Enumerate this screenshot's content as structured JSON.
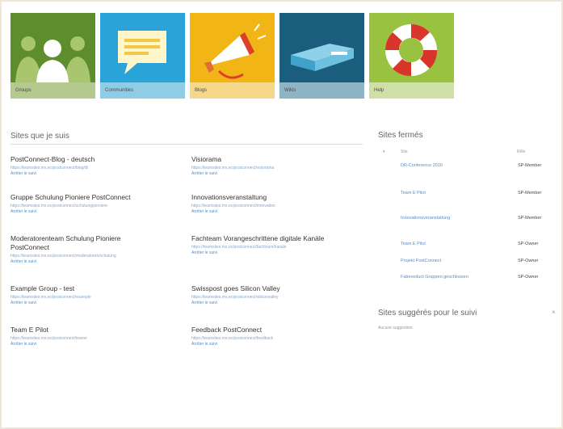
{
  "tiles": [
    {
      "label": "Groups",
      "bg": "#5e8d2c",
      "cap_bg": "#b3c98e",
      "icon": "people-icon"
    },
    {
      "label": "Communities",
      "bg": "#2aa3d8",
      "cap_bg": "#8fcde6",
      "icon": "speech-bubble-icon"
    },
    {
      "label": "Blogs",
      "bg": "#f1b515",
      "cap_bg": "#f5d88a",
      "icon": "megaphone-icon"
    },
    {
      "label": "Wikis",
      "bg": "#1a5d7c",
      "cap_bg": "#8db5c6",
      "icon": "book-icon"
    },
    {
      "label": "Help",
      "bg": "#98c23f",
      "cap_bg": "#cfe0a7",
      "icon": "lifebuoy-icon"
    }
  ],
  "followed": {
    "title": "Sites que je suis",
    "stop_label": "Arrêter le suivi",
    "left": [
      {
        "name": "PostConnect-Blog - deutsch",
        "url": "https://teamsites.ms.ec/postconnect/blog/dt"
      },
      {
        "name": "Gruppe Schulung Pioniere PostConnect",
        "url": "https://teamsites.ms.ec/postconnect/schulung/pioniere"
      },
      {
        "name": "Moderatorenteam Schulung Pioniere PostConnect",
        "url": "https://teamsites.ms.ec/postconnect/moderatoren/schulung"
      },
      {
        "name": "Example Group - test",
        "url": "https://teamsites.ms.ec/postconnect/example"
      },
      {
        "name": "Team E Pilot",
        "url": "https://teamsites.ms.ec/postconnect/teame"
      }
    ],
    "right": [
      {
        "name": "Visiorama",
        "url": "https://teamsites.ms.ec/postconnect/visiorama"
      },
      {
        "name": "Innovationsveranstaltung",
        "url": "https://teamsites.ms.ec/postconnect/innovation"
      },
      {
        "name": "Fachteam Vorangeschrittene digitale Kanäle",
        "url": "https://teamsites.ms.ec/postconnect/fachteam/kanale"
      },
      {
        "name": "Swisspost goes Silicon Valley",
        "url": "https://teamsites.ms.ec/postconnect/siliconvalley"
      },
      {
        "name": "Feedback PostConnect",
        "url": "https://teamsites.ms.ec/postconnect/feedback"
      }
    ]
  },
  "recent": {
    "title": "Sites fermés",
    "col_site": "Site",
    "col_role": "Rôle",
    "rows": [
      {
        "name": "DR-Conference 2016",
        "role": "SP-Member"
      },
      {
        "name": "Team E Pilot",
        "role": "SP-Member"
      },
      {
        "name": "Innovationsveranstaltung",
        "role": "SP-Member"
      },
      {
        "name": "Team E Pilot",
        "role": "SP-Owner"
      },
      {
        "name": "Projekt PostConnect",
        "role": "SP-Owner"
      },
      {
        "name": "Fabeveduct Gruppen geschlossen",
        "role": "SP-Owner"
      }
    ]
  },
  "suggested": {
    "title": "Sites suggérés pour le suivi",
    "empty_text": "Aucune suggestion"
  }
}
